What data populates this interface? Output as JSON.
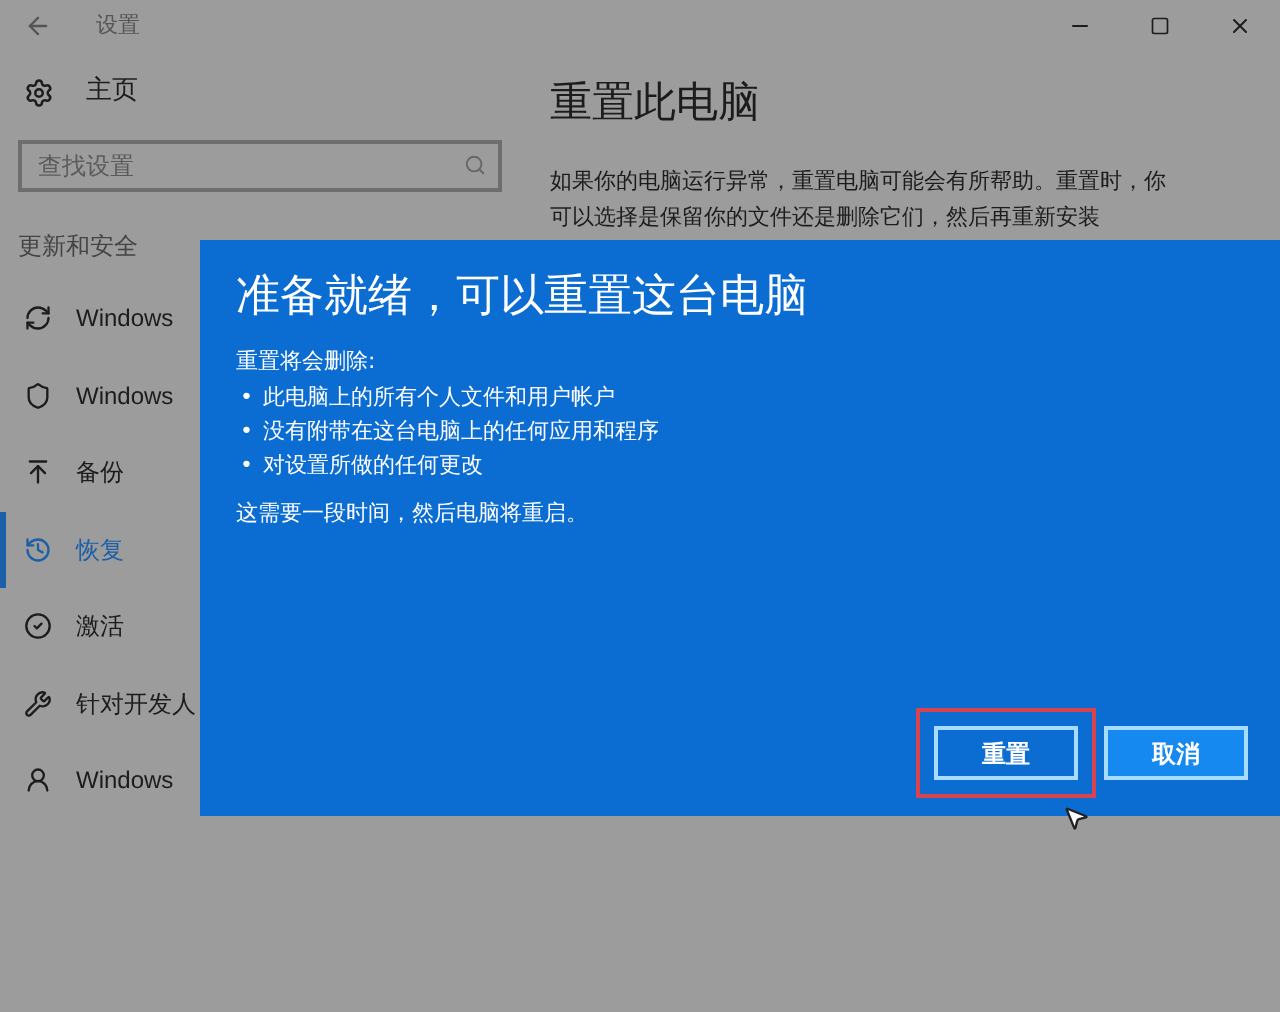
{
  "window": {
    "title": "设置"
  },
  "sidebar": {
    "home": "主页",
    "search": {
      "placeholder": "查找设置"
    },
    "section": "更新和安全",
    "items": [
      {
        "kind": "sync",
        "label": "Windows",
        "selected": false
      },
      {
        "kind": "shield",
        "label": "Windows",
        "selected": false
      },
      {
        "kind": "backup",
        "label": "备份",
        "selected": false
      },
      {
        "kind": "history",
        "label": "恢复",
        "selected": true
      },
      {
        "kind": "check",
        "label": "激活",
        "selected": false
      },
      {
        "kind": "dev",
        "label": "针对开发人",
        "selected": false
      },
      {
        "kind": "user",
        "label": "Windows",
        "selected": false
      }
    ]
  },
  "content": {
    "heading": "重置此电脑",
    "lines": [
      "如果你的电脑运行异常，重置电脑可能会有所帮助。重置时，你",
      "可以选择是保留你的文件还是删除它们，然后再重新安装"
    ]
  },
  "dialog": {
    "title": "准备就绪，可以重置这台电脑",
    "intro": "重置将会删除:",
    "bullet_mark": "•",
    "bullets": [
      "此电脑上的所有个人文件和用户帐户",
      "没有附带在这台电脑上的任何应用和程序",
      "对设置所做的任何更改"
    ],
    "note": "这需要一段时间，然后电脑将重启。",
    "buttons": [
      {
        "label": "重置",
        "highlighted": true
      },
      {
        "label": "取消",
        "highlighted": false
      }
    ]
  }
}
